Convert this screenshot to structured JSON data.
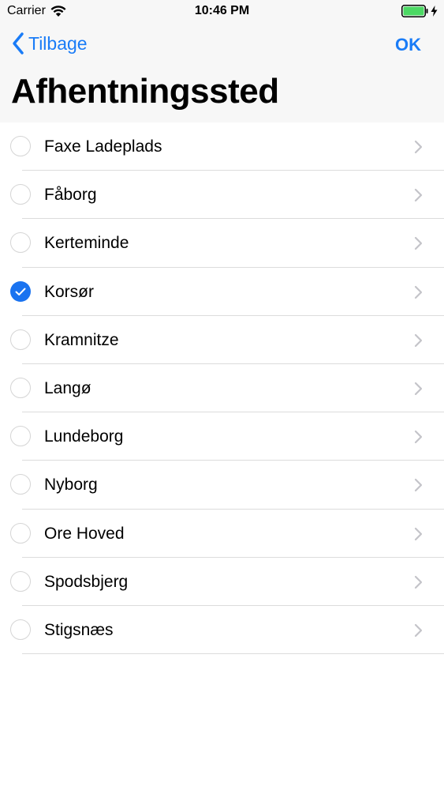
{
  "status_bar": {
    "carrier": "Carrier",
    "time": "10:46 PM",
    "battery_color": "#4cd964"
  },
  "nav": {
    "back_label": "Tilbage",
    "ok_label": "OK",
    "title": "Afhentningssted"
  },
  "colors": {
    "accent": "#1a7cf7",
    "checked": "#1a73f0"
  },
  "locations": [
    {
      "label": "Faxe Ladeplads",
      "selected": false
    },
    {
      "label": "Fåborg",
      "selected": false
    },
    {
      "label": "Kerteminde",
      "selected": false
    },
    {
      "label": "Korsør",
      "selected": true
    },
    {
      "label": "Kramnitze",
      "selected": false
    },
    {
      "label": "Langø",
      "selected": false
    },
    {
      "label": "Lundeborg",
      "selected": false
    },
    {
      "label": "Nyborg",
      "selected": false
    },
    {
      "label": "Ore Hoved",
      "selected": false
    },
    {
      "label": "Spodsbjerg",
      "selected": false
    },
    {
      "label": "Stigsnæs",
      "selected": false
    }
  ]
}
